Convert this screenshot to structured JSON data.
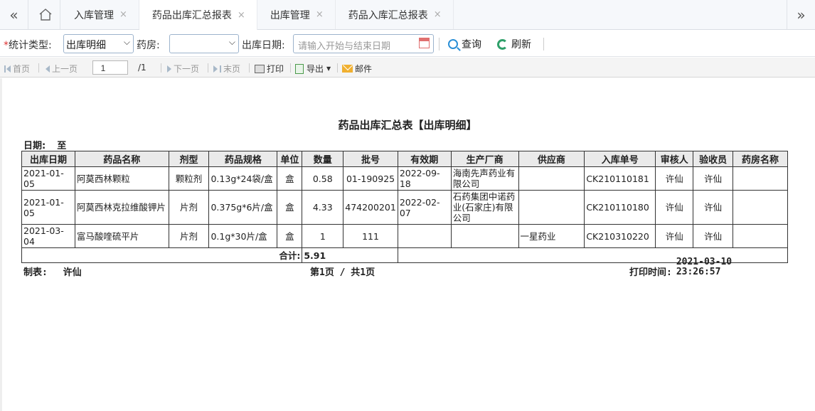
{
  "tabbar": {
    "tabs": [
      {
        "label": "入库管理"
      },
      {
        "label": "药品出库汇总报表"
      },
      {
        "label": "出库管理"
      },
      {
        "label": "药品入库汇总报表"
      }
    ],
    "close": "×",
    "prev": "«",
    "next": "»"
  },
  "filters": {
    "type_label": "统计类型:",
    "type_required": "*",
    "type_value": "出库明细",
    "pharmacy_label": "药房:",
    "pharmacy_value": "",
    "date_label": "出库日期:",
    "date_placeholder": "请输入开始与结束日期",
    "query_label": "查询",
    "refresh_label": "刷新"
  },
  "pager": {
    "first": "首页",
    "prev": "上一页",
    "page_value": "1",
    "total": "/1",
    "next": "下一页",
    "last": "末页",
    "print": "打印",
    "export": "导出",
    "mail": "邮件"
  },
  "report": {
    "title": "药品出库汇总表【出库明细】",
    "date_label": "日期:",
    "date_to": "至",
    "columns": [
      "出库日期",
      "药品名称",
      "剂型",
      "药品规格",
      "单位",
      "数量",
      "批号",
      "有效期",
      "生产厂商",
      "供应商",
      "入库单号",
      "审核人",
      "验收员",
      "药房名称"
    ],
    "rows": [
      {
        "date": "2021-01-05",
        "name": "阿莫西林颗粒",
        "form": "颗粒剂",
        "spec": "0.13g*24袋/盒",
        "unit": "盒",
        "qty": "0.58",
        "batch": "01-190925",
        "expiry": "2022-09-18",
        "maker": "海南先声药业有限公司",
        "supplier": "",
        "order": "CK210110181",
        "reviewer": "许仙",
        "checker": "许仙",
        "pharmacy": ""
      },
      {
        "date": "2021-01-05",
        "name": "阿莫西林克拉维酸钾片",
        "form": "片剂",
        "spec": "0.375g*6片/盒",
        "unit": "盒",
        "qty": "4.33",
        "batch": "474200201",
        "expiry": "2022-02-07",
        "maker": "石药集团中诺药业(石家庄)有限公司",
        "supplier": "",
        "order": "CK210110180",
        "reviewer": "许仙",
        "checker": "许仙",
        "pharmacy": ""
      },
      {
        "date": "2021-03-04",
        "name": "富马酸喹硫平片",
        "form": "片剂",
        "spec": "0.1g*30片/盒",
        "unit": "盒",
        "qty": "1",
        "batch": "111",
        "expiry": "",
        "maker": "",
        "supplier": "一星药业",
        "order": "CK210310220",
        "reviewer": "许仙",
        "checker": "许仙",
        "pharmacy": ""
      }
    ],
    "total_label": "合计:",
    "total_value": "5.91",
    "maker_label": "制表:",
    "maker_name": "许仙",
    "page_info": "第1页 / 共1页",
    "print_time_label": "打印时间:",
    "print_date": "2021-03-10",
    "print_clock": "23:26:57"
  }
}
